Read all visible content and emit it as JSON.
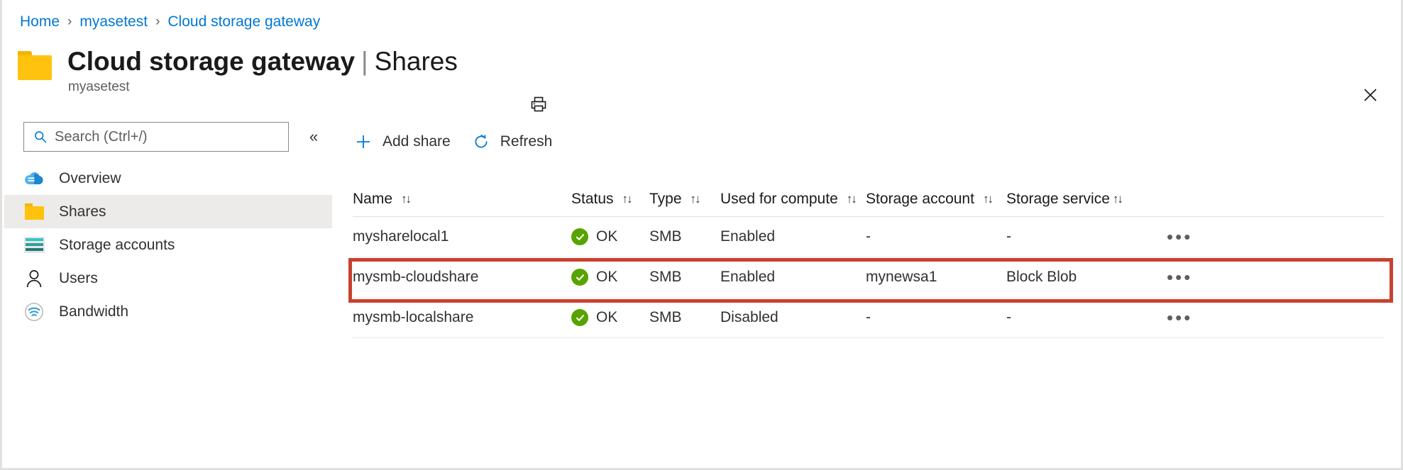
{
  "breadcrumb": {
    "items": [
      {
        "label": "Home"
      },
      {
        "label": "myasetest"
      },
      {
        "label": "Cloud storage gateway"
      }
    ],
    "separator": "›"
  },
  "header": {
    "title": "Cloud storage gateway",
    "title_separator": "|",
    "title_suffix": "Shares",
    "subtitle": "myasetest",
    "print_icon": "print-icon",
    "close_icon": "close-icon",
    "resource_icon": "folder-icon"
  },
  "sidebar": {
    "search": {
      "placeholder": "Search (Ctrl+/)",
      "value": "",
      "icon": "search-icon"
    },
    "collapse": {
      "icon": "chevron-double-left-icon",
      "glyph": "«"
    },
    "items": [
      {
        "label": "Overview",
        "icon": "cloud-icon",
        "selected": false
      },
      {
        "label": "Shares",
        "icon": "folder-icon",
        "selected": true
      },
      {
        "label": "Storage accounts",
        "icon": "storage-accounts-icon",
        "selected": false
      },
      {
        "label": "Users",
        "icon": "user-icon",
        "selected": false
      },
      {
        "label": "Bandwidth",
        "icon": "bandwidth-icon",
        "selected": false
      }
    ]
  },
  "toolbar": {
    "buttons": [
      {
        "label": "Add share",
        "icon": "plus-icon"
      },
      {
        "label": "Refresh",
        "icon": "refresh-icon"
      }
    ]
  },
  "table": {
    "sort_glyph": "↑↓",
    "columns": [
      {
        "key": "name",
        "label": "Name",
        "sortable": true
      },
      {
        "key": "status",
        "label": "Status",
        "sortable": true
      },
      {
        "key": "type",
        "label": "Type",
        "sortable": true
      },
      {
        "key": "used",
        "label": "Used for compute",
        "sortable": true
      },
      {
        "key": "account",
        "label": "Storage account",
        "sortable": true
      },
      {
        "key": "service",
        "label": "Storage service",
        "sortable": true
      }
    ],
    "rows": [
      {
        "name": "mysharelocal1",
        "status": "OK",
        "status_icon": "check-circle-icon",
        "type": "SMB",
        "used": "Enabled",
        "account": "-",
        "service": "-",
        "more_icon": "ellipsis-icon",
        "highlighted": false
      },
      {
        "name": "mysmb-cloudshare",
        "status": "OK",
        "status_icon": "check-circle-icon",
        "type": "SMB",
        "used": "Enabled",
        "account": "mynewsa1",
        "service": "Block Blob",
        "more_icon": "ellipsis-icon",
        "highlighted": true
      },
      {
        "name": "mysmb-localshare",
        "status": "OK",
        "status_icon": "check-circle-icon",
        "type": "SMB",
        "used": "Disabled",
        "account": "-",
        "service": "-",
        "more_icon": "ellipsis-icon",
        "highlighted": false
      }
    ],
    "more_glyph": "•••"
  },
  "colors": {
    "link": "#0078d4",
    "accent": "#0078d4",
    "folder": "#ffc20e",
    "status_ok": "#57a300",
    "highlight": "#c8412f",
    "selected_row_bg": "#edebe9"
  }
}
